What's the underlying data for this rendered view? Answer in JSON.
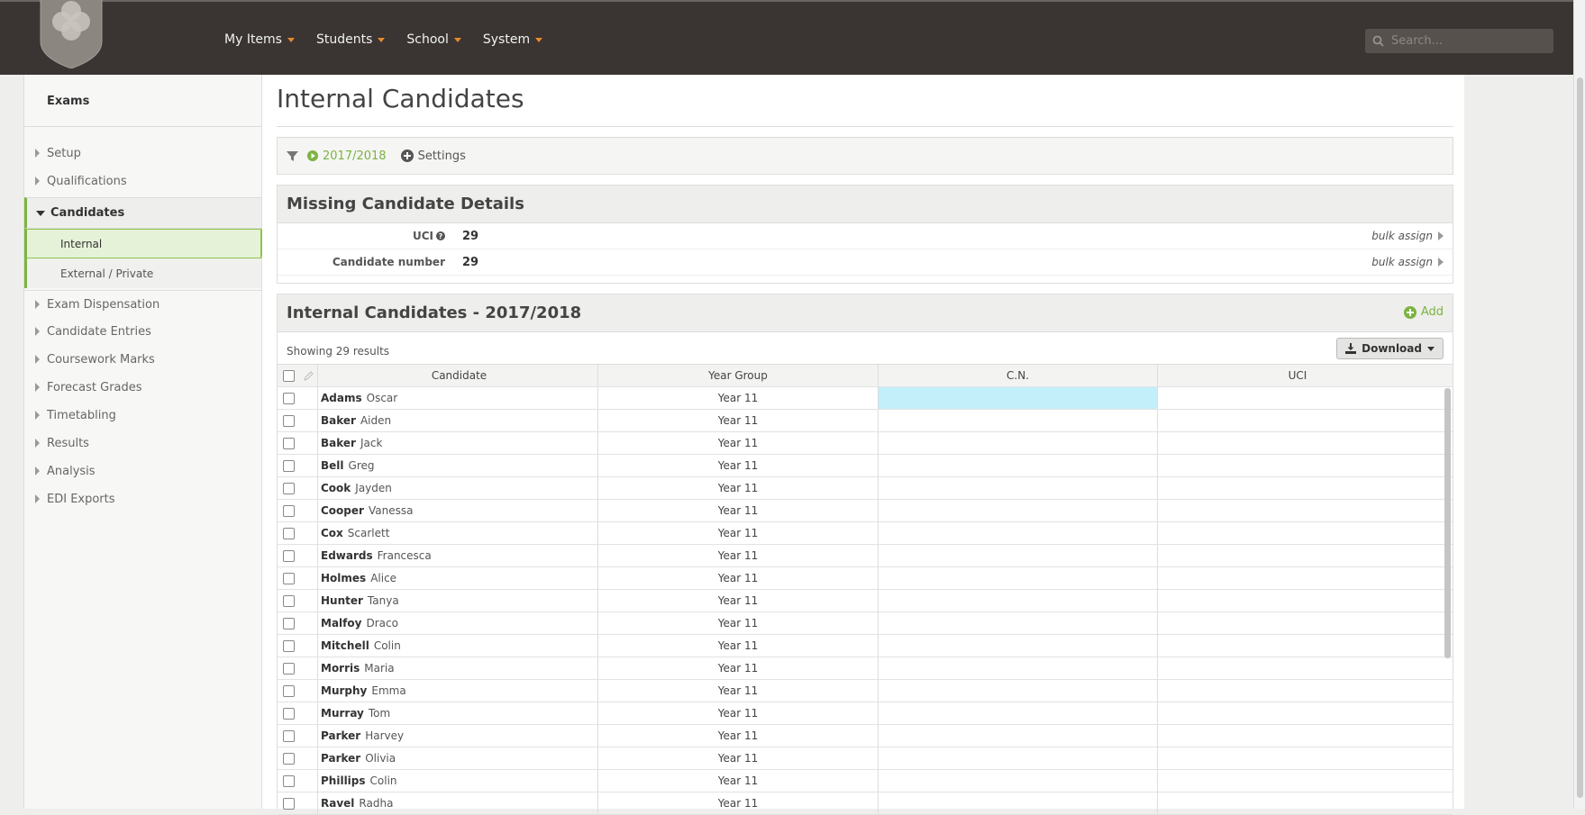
{
  "nav": {
    "items": [
      "My Items",
      "Students",
      "School",
      "System"
    ],
    "search_placeholder": "Search..."
  },
  "colors": {
    "topbar": "#3a3532",
    "accent_green": "#7cb342",
    "caret_orange": "#e8892b",
    "selected_cell": "#c3effa"
  },
  "sidebar": {
    "title": "Exams",
    "items": {
      "setup": "Setup",
      "qualifications": "Qualifications",
      "candidates": "Candidates",
      "internal": "Internal",
      "external": "External / Private",
      "exam_dispensation": "Exam Dispensation",
      "candidate_entries": "Candidate Entries",
      "coursework_marks": "Coursework Marks",
      "forecast_grades": "Forecast Grades",
      "timetabling": "Timetabling",
      "results": "Results",
      "analysis": "Analysis",
      "edi_exports": "EDI Exports"
    }
  },
  "page": {
    "title": "Internal Candidates"
  },
  "filter": {
    "year": "2017/2018",
    "settings": "Settings"
  },
  "missing": {
    "title": "Missing Candidate Details",
    "uci_label": "UCI",
    "uci_value": "29",
    "cn_label": "Candidate number",
    "cn_value": "29",
    "bulk_label": "bulk assign"
  },
  "candidates": {
    "title": "Internal Candidates - 2017/2018",
    "add_label": "Add",
    "showing": "Showing 29 results",
    "download_label": "Download",
    "columns": {
      "candidate": "Candidate",
      "year_group": "Year Group",
      "cn": "C.N.",
      "uci": "UCI"
    },
    "rows": [
      {
        "surname": "Adams",
        "forename": "Oscar",
        "year": "Year 11"
      },
      {
        "surname": "Baker",
        "forename": "Aiden",
        "year": "Year 11"
      },
      {
        "surname": "Baker",
        "forename": "Jack",
        "year": "Year 11"
      },
      {
        "surname": "Bell",
        "forename": "Greg",
        "year": "Year 11"
      },
      {
        "surname": "Cook",
        "forename": "Jayden",
        "year": "Year 11"
      },
      {
        "surname": "Cooper",
        "forename": "Vanessa",
        "year": "Year 11"
      },
      {
        "surname": "Cox",
        "forename": "Scarlett",
        "year": "Year 11"
      },
      {
        "surname": "Edwards",
        "forename": "Francesca",
        "year": "Year 11"
      },
      {
        "surname": "Holmes",
        "forename": "Alice",
        "year": "Year 11"
      },
      {
        "surname": "Hunter",
        "forename": "Tanya",
        "year": "Year 11"
      },
      {
        "surname": "Malfoy",
        "forename": "Draco",
        "year": "Year 11"
      },
      {
        "surname": "Mitchell",
        "forename": "Colin",
        "year": "Year 11"
      },
      {
        "surname": "Morris",
        "forename": "Maria",
        "year": "Year 11"
      },
      {
        "surname": "Murphy",
        "forename": "Emma",
        "year": "Year 11"
      },
      {
        "surname": "Murray",
        "forename": "Tom",
        "year": "Year 11"
      },
      {
        "surname": "Parker",
        "forename": "Harvey",
        "year": "Year 11"
      },
      {
        "surname": "Parker",
        "forename": "Olivia",
        "year": "Year 11"
      },
      {
        "surname": "Phillips",
        "forename": "Colin",
        "year": "Year 11"
      },
      {
        "surname": "Ravel",
        "forename": "Radha",
        "year": "Year 11"
      }
    ]
  }
}
